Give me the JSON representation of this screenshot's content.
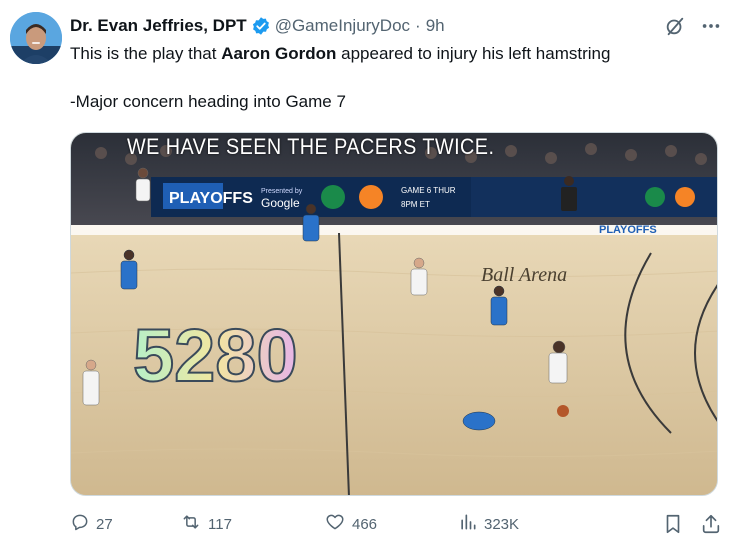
{
  "author": {
    "name": "Dr. Evan Jeffries, DPT",
    "handle": "@GameInjuryDoc",
    "separator": "·",
    "time": "9h"
  },
  "tweet": {
    "line1_prefix": "This is the play that ",
    "line1_bold": "Aaron Gordon",
    "line1_suffix": " appeared to injury his left hamstring",
    "line2": "-Major concern heading into Game 7"
  },
  "media": {
    "caption": "WE HAVE SEEN THE PACERS TWICE.",
    "banner_left": "PLAYOFFS",
    "banner_presented": "Presented by",
    "banner_brand": "Google",
    "banner_score": "GAME 6 THUR",
    "banner_score2": "8PM ET",
    "banner_right": "PLAYOFFS",
    "arena": "Ball Arena",
    "court_number": "5280"
  },
  "actions": {
    "replies": "27",
    "reposts": "117",
    "likes": "466",
    "views": "323K"
  },
  "icons": {
    "reply": "reply-icon",
    "repost": "repost-icon",
    "like": "heart-icon",
    "views": "views-icon",
    "bookmark": "bookmark-icon",
    "share": "share-icon",
    "grok": "grok-icon",
    "more": "more-icon",
    "verified": "verified-badge-icon"
  },
  "colors": {
    "verified": "#1d9bf0",
    "secondary_text": "#536471",
    "primary_text": "#0f1419"
  }
}
